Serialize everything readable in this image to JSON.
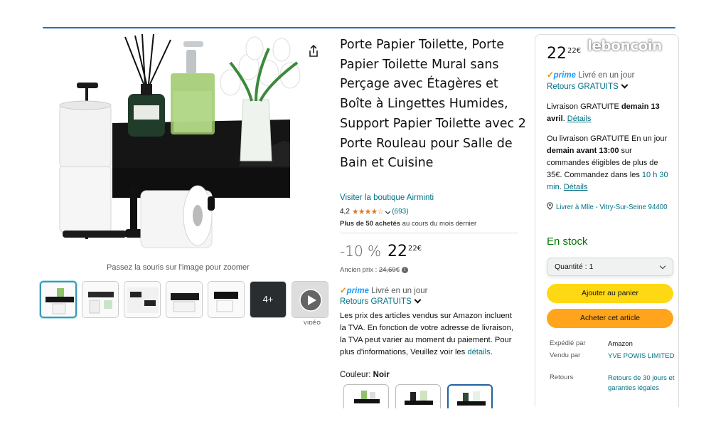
{
  "watermark": "leboncoin",
  "gallery": {
    "zoom_hint": "Passez la souris sur l'image pour zoomer",
    "more_thumbs": "4+",
    "video_label": "VIDÉO"
  },
  "product": {
    "title": "Porte Papier Toilette, Porte Papier Toilette Mural sans Perçage avec Étagères et Boîte à Lingettes Humides, Support Papier Toilette avec 2 Porte Rouleau pour Salle de Bain et Cuisine",
    "store_link": "Visiter la boutique Airminti",
    "rating_value": "4,2",
    "stars": "★★★★☆",
    "rating_count": "(693)",
    "bought_bold": "Plus de 50 achetés",
    "bought_rest": " au cours du mois dernier",
    "discount": "-10 %",
    "price_whole": "22",
    "price_cents": "22€",
    "old_price_label": "Ancien prix : ",
    "old_price": "24,69€",
    "prime_check": "✓",
    "prime": "prime",
    "prime_delivery": " Livré en un jour",
    "returns": "Retours GRATUITS",
    "tva_text": "Les prix des articles vendus sur Amazon incluent la TVA. En fonction de votre adresse de livraison, la TVA peut varier au moment du paiement. Pour plus d'informations, Veuillez voir les ",
    "tva_link": "détails",
    "tva_end": ".",
    "color_label": "Couleur: ",
    "color_value": "Noir"
  },
  "buybox": {
    "price_whole": "22",
    "price_cents": "22€",
    "prime_check": "✓",
    "prime": "prime",
    "prime_delivery": " Livré en un jour",
    "returns": "Retours GRATUITS",
    "delivery_1": "Livraison GRATUITE ",
    "delivery_1_bold": "demain 13 avril",
    "delivery_1_end": ". ",
    "details": "Détails",
    "delivery_2": "Ou livraison GRATUITE En un jour ",
    "delivery_2_bold": "demain avant 13:00",
    "delivery_2_mid": " sur commandes éligibles de plus de 35€. Commandez dans les ",
    "delivery_2_time": "10 h 30 min",
    "delivery_2_end": ". ",
    "location": "Livrer à Mlle - Vitry-Sur-Seine 94400",
    "stock": "En stock",
    "quantity": "Quantité : 1",
    "add_to_cart": "Ajouter au panier",
    "buy_now": "Acheter cet article",
    "shipped_by_label": "Expédié par",
    "shipped_by": "Amazon",
    "sold_by_label": "Vendu par",
    "sold_by": "YVE POWIS LIMITED",
    "returns_label": "Retours",
    "returns_value": "Retours de 30 jours et garanties légales"
  },
  "colors": {
    "link": "#007185",
    "cart_button": "#ffd814",
    "buy_button": "#ffa41c",
    "in_stock": "#007600",
    "stars": "#de7921",
    "prime": "#1a98ff"
  }
}
